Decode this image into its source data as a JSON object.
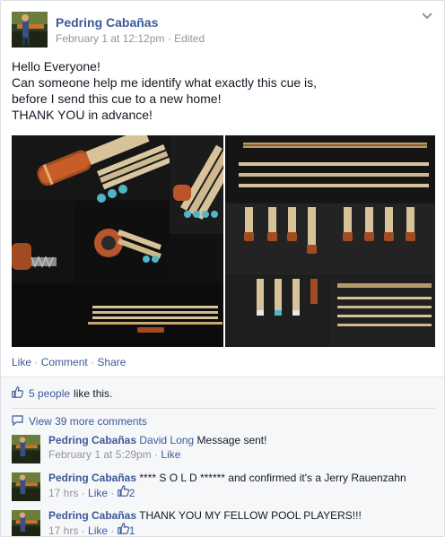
{
  "post": {
    "author": "Pedring Cabañas",
    "timestamp": "February 1 at 12:12pm",
    "edited_label": "Edited",
    "meta_separator": "·",
    "text_lines": [
      "Hello Everyone!",
      "Can someone help me identify what exactly this cue is,",
      "before I send this cue to a new home!",
      "THANK YOU in advance!"
    ],
    "actions": {
      "like": "Like",
      "comment": "Comment",
      "share": "Share",
      "separator": "·"
    }
  },
  "ufi": {
    "likes_link": "5 people",
    "likes_rest": "like this.",
    "view_more": "View 39 more comments"
  },
  "comments": [
    {
      "author": "Pedring Cabañas",
      "mention": "David Long",
      "text": "Message sent!",
      "time": "February 1 at 5:29pm",
      "separator": "·",
      "like": "Like",
      "like_count": ""
    },
    {
      "author": "Pedring Cabañas",
      "mention": "",
      "text": "**** S O L D ****** and confirmed it's a Jerry Rauenzahn",
      "time": "17 hrs",
      "separator": "·",
      "like": "Like",
      "like_count": "2"
    },
    {
      "author": "Pedring Cabañas",
      "mention": "",
      "text": "THANK YOU MY FELLOW POOL PLAYERS!!!",
      "time": "17 hrs",
      "separator": "·",
      "like": "Like",
      "like_count": "1"
    }
  ],
  "colors": {
    "link": "#3b5998",
    "meta": "#90949c",
    "ufi_bg": "#f6f7f9"
  },
  "icons": [
    "chevron-down-icon",
    "thumbs-up-icon",
    "speech-bubble-icon"
  ]
}
